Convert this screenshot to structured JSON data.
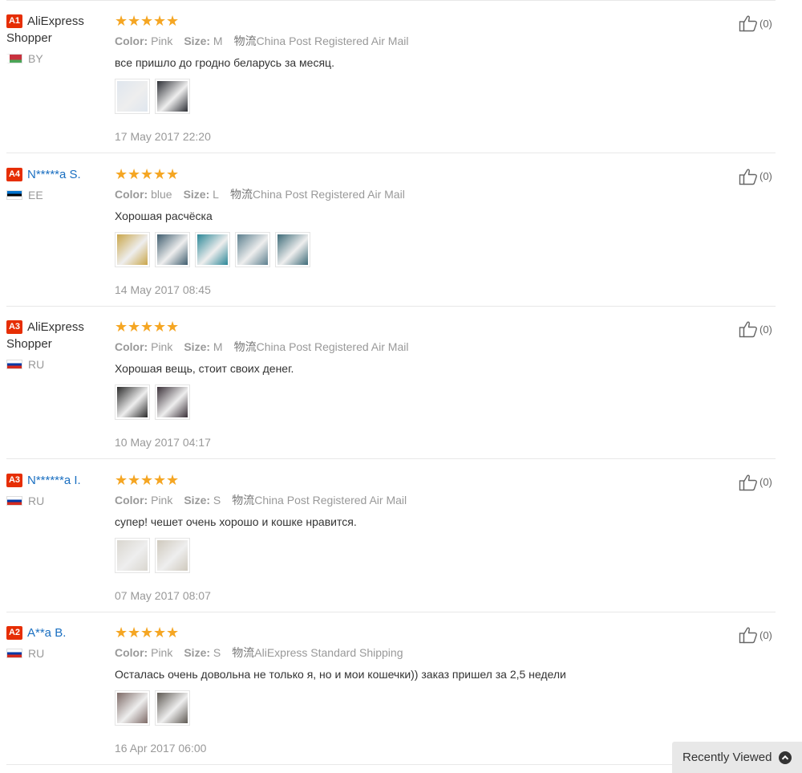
{
  "reviews": [
    {
      "level": "A1",
      "user": "AliExpress Shopper",
      "masked": false,
      "country": "BY",
      "color_label": "Color:",
      "color": "Pink",
      "size_label": "Size:",
      "size": "M",
      "shipping_label": "物流",
      "shipping": "China Post Registered Air Mail",
      "text": "все пришло до гродно беларусь за месяц.",
      "photos": [
        "photo",
        "photo"
      ],
      "date": "17 May 2017 22:20",
      "helpful": "(0)"
    },
    {
      "level": "A4",
      "user": "N*****a S.",
      "masked": true,
      "country": "EE",
      "color_label": "Color:",
      "color": "blue",
      "size_label": "Size:",
      "size": "L",
      "shipping_label": "物流",
      "shipping": "China Post Registered Air Mail",
      "text": "Хорошая расчёска",
      "photos": [
        "photo",
        "photo",
        "photo",
        "photo",
        "photo"
      ],
      "date": "14 May 2017 08:45",
      "helpful": "(0)"
    },
    {
      "level": "A3",
      "user": "AliExpress Shopper",
      "masked": false,
      "country": "RU",
      "color_label": "Color:",
      "color": "Pink",
      "size_label": "Size:",
      "size": "M",
      "shipping_label": "物流",
      "shipping": "China Post Registered Air Mail",
      "text": "Хорошая вещь, стоит своих денег.",
      "photos": [
        "photo",
        "photo"
      ],
      "date": "10 May 2017 04:17",
      "helpful": "(0)"
    },
    {
      "level": "A3",
      "user": "N******a I.",
      "masked": true,
      "country": "RU",
      "color_label": "Color:",
      "color": "Pink",
      "size_label": "Size:",
      "size": "S",
      "shipping_label": "物流",
      "shipping": "China Post Registered Air Mail",
      "text": "супер! чешет очень хорошо и кошке нравится.",
      "photos": [
        "photo",
        "photo"
      ],
      "date": "07 May 2017 08:07",
      "helpful": "(0)"
    },
    {
      "level": "A2",
      "user": "A**a B.",
      "masked": true,
      "country": "RU",
      "color_label": "Color:",
      "color": "Pink",
      "size_label": "Size:",
      "size": "S",
      "shipping_label": "物流",
      "shipping": "AliExpress Standard Shipping",
      "text": "Осталась очень довольна не только я, но и мои кошечки)) заказ пришел за 2,5 недели",
      "photos": [
        "photo",
        "photo"
      ],
      "date": "16 Apr 2017 06:00",
      "helpful": "(0)"
    }
  ],
  "rating_stars": 5,
  "recently_viewed": {
    "label": "Recently Viewed",
    "icon": "chevron-up-icon"
  },
  "colors": {
    "star": "#f5a623",
    "level_badge": "#e62e04",
    "masked_name": "#1a6fc1"
  }
}
